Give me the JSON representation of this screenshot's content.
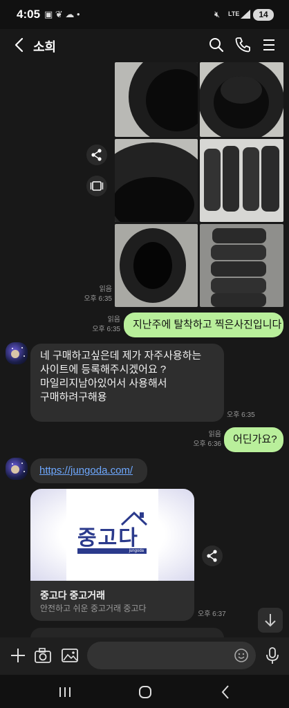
{
  "status_bar": {
    "time": "4:05",
    "network": "LTE",
    "battery": "14"
  },
  "header": {
    "title": "소희"
  },
  "chat": {
    "photo_block": {
      "read": "읽음",
      "time": "오후 6:35"
    },
    "out1": {
      "read": "읽음",
      "time": "오후 6:35",
      "text": "지난주에 탈착하고 찍은사진입니다"
    },
    "in1": {
      "lines": [
        "네 구매하고싶은데 제가 자주사용하는",
        "사이트에 등록해주시겠어요 ?",
        "마일리지남아있어서 사용해서",
        "구매하려구해용"
      ],
      "time": "오후 6:35"
    },
    "out2": {
      "read": "읽음",
      "time": "오후 6:36",
      "text": "어딘가요?"
    },
    "in2": {
      "link": "https://jungoda.com/",
      "card_logo": "중고다",
      "card_logo_sub": "jungoda",
      "card_title": "중고다 중고거래",
      "card_desc": "안전하고 쉬운 중고거래 중고다",
      "time": "오후 6:37"
    }
  },
  "input": {
    "placeholder": ""
  },
  "colors": {
    "background": "#181818",
    "incoming_bubble": "#2e2e2e",
    "outgoing_bubble": "#b9ef9b",
    "link": "#6ea8ff",
    "logo_navy": "#2b3a8c"
  }
}
